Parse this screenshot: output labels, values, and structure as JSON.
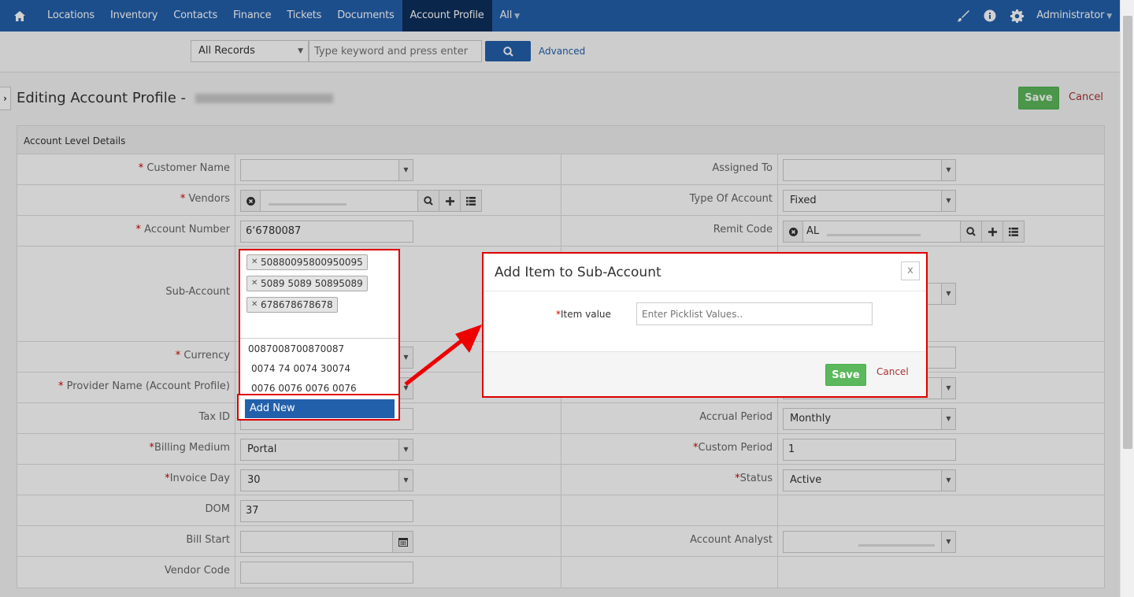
{
  "nav": {
    "items": [
      "Locations",
      "Inventory",
      "Contacts",
      "Finance",
      "Tickets",
      "Documents",
      "Account Profile",
      "All"
    ],
    "active": "Account Profile",
    "user": "Administrator",
    "icons": [
      "home-icon",
      "brush-icon",
      "info-icon",
      "gear-icon"
    ]
  },
  "search": {
    "scope": "All Records",
    "placeholder": "Type keyword and press enter",
    "advanced": "Advanced"
  },
  "header": {
    "title": "Editing Account Profile - ",
    "save": "Save",
    "cancel": "Cancel"
  },
  "section": {
    "title": "Account Level Details"
  },
  "fields": {
    "customer_name": "Customer Name",
    "vendors": "Vendors",
    "account_number": "Account Number",
    "account_number_value": "6‘6780087",
    "sub_account": "Sub-Account",
    "currency": "Currency",
    "provider_name": "Provider Name (Account Profile)",
    "tax_id": "Tax ID",
    "billing_medium": "Billing Medium",
    "billing_medium_value": "Portal",
    "invoice_day": "Invoice Day",
    "invoice_day_value": "30",
    "dom": "DOM",
    "dom_value": "37",
    "bill_start": "Bill Start",
    "vendor_code": "Vendor Code",
    "assigned_to": "Assigned To",
    "type_of_account": "Type Of Account",
    "type_of_account_value": "Fixed",
    "remit_code": "Remit Code",
    "remit_code_value": "AL",
    "accrual_period": "Accrual Period",
    "accrual_period_value": "Monthly",
    "custom_period": "Custom Period",
    "custom_period_value": "1",
    "status": "Status",
    "status_value": "Active",
    "account_analyst": "Account Analyst"
  },
  "subaccount": {
    "chips": [
      "50880095800950095",
      "5089 5089 50895089",
      "678678678678"
    ],
    "options": [
      "0087008700870087",
      "0074 74  0074  30074",
      "0076 0076 0076 0076"
    ],
    "add_new": "Add New"
  },
  "modal": {
    "title": "Add Item to Sub-Account",
    "close": "x",
    "item_label": "*Item value",
    "item_placeholder": "Enter Picklist Values..",
    "save": "Save",
    "cancel": "Cancel"
  }
}
